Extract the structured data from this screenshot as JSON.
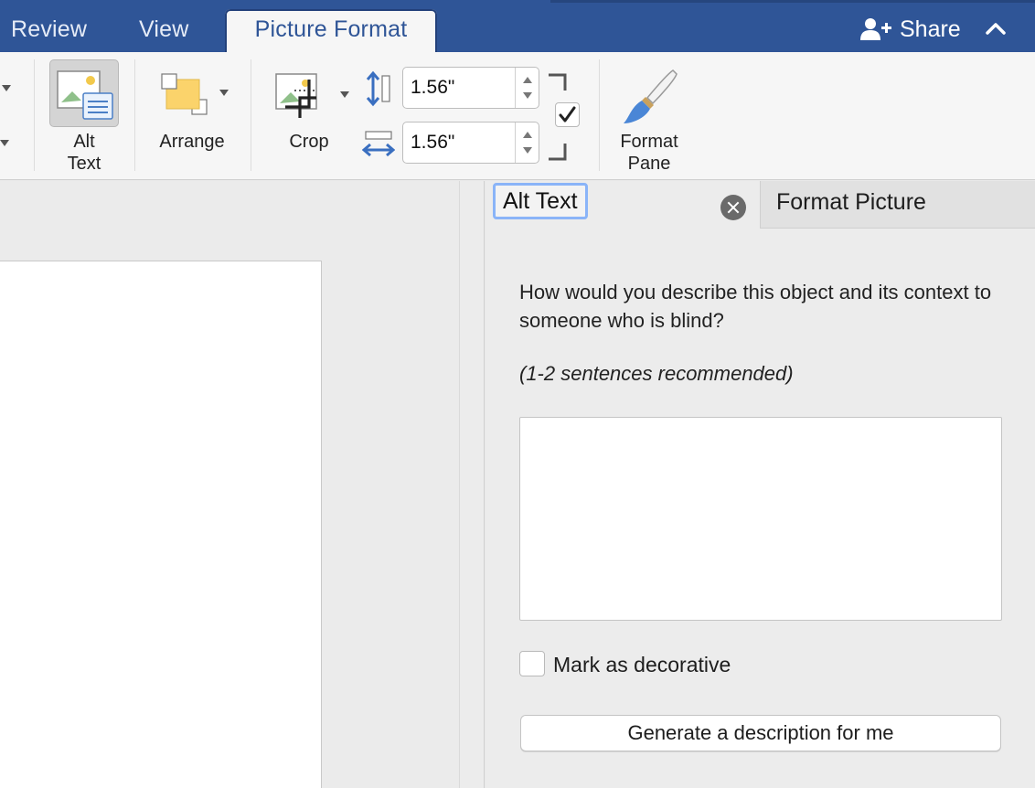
{
  "tabs": {
    "review": "Review",
    "view": "View",
    "picture_format": "Picture Format"
  },
  "share": {
    "label": "Share",
    "icon": "person-add-icon"
  },
  "ribbon": {
    "alt_text": {
      "line1": "Alt",
      "line2": "Text",
      "icon": "alt-text-icon"
    },
    "arrange": {
      "label": "Arrange",
      "icon": "arrange-icon"
    },
    "crop": {
      "label": "Crop",
      "icon": "crop-icon"
    },
    "height": {
      "value": "1.56\"",
      "icon": "height-arrow-icon"
    },
    "width": {
      "value": "1.56\"",
      "icon": "width-arrow-icon"
    },
    "lock_aspect_checked": true,
    "format_pane": {
      "line1": "Format",
      "line2": "Pane",
      "icon": "paintbrush-icon"
    }
  },
  "pane": {
    "tab_alt_text": "Alt Text",
    "tab_format_picture": "Format Picture",
    "prompt": "How would you describe this object and its context to someone who is blind?",
    "hint": "(1-2 sentences recommended)",
    "description_value": "",
    "decorative_label": "Mark as decorative",
    "decorative_checked": false,
    "generate_label": "Generate a description for me"
  },
  "colors": {
    "title_bar": "#2f5597",
    "ribbon_bg": "#f6f6f6",
    "pane_bg": "#ececec",
    "focus_ring": "#8ab4f8"
  }
}
